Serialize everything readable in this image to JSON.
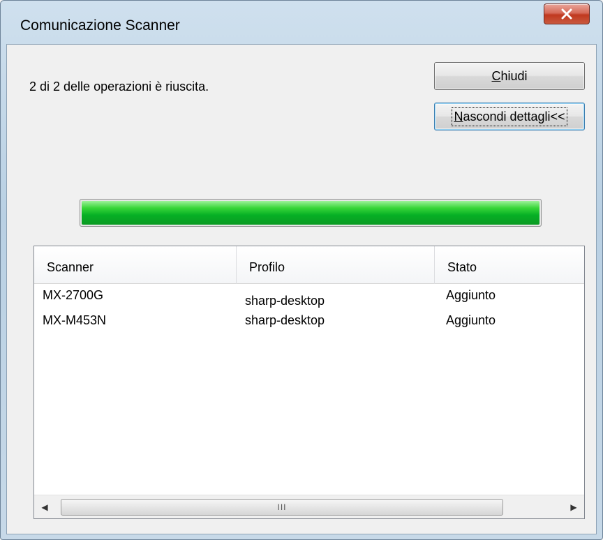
{
  "window": {
    "title": "Comunicazione Scanner",
    "close_icon": "close-icon"
  },
  "status": {
    "message": "2 di 2 delle operazioni è riuscita."
  },
  "buttons": {
    "close": {
      "mnemonic": "C",
      "rest": "hiudi"
    },
    "details": {
      "mnemonic": "N",
      "rest": "ascondi dettagli<<"
    }
  },
  "progress": {
    "fraction": 1.0,
    "color": "#06b025"
  },
  "table": {
    "columns": [
      "Scanner",
      "Profilo",
      "Stato"
    ],
    "rows": [
      {
        "scanner": "MX-2700G",
        "profilo": "sharp-desktop",
        "stato": "Aggiunto"
      },
      {
        "scanner": "MX-M453N",
        "profilo": "sharp-desktop",
        "stato": "Aggiunto"
      }
    ]
  },
  "scrollbar": {
    "grip": "III"
  }
}
